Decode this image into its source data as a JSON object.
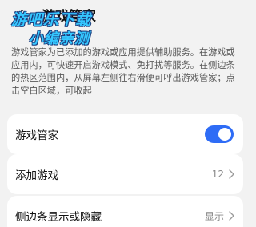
{
  "header": {
    "title": "游戏管家",
    "watermark_line1": "游吧乐下载",
    "watermark_line2": "小编亲测"
  },
  "description": "游戏管家为已添加的游戏或应用提供辅助服务。在游戏或应用内，可快速开启游戏模式、免打扰等服务。在侧边条的热区范围内，从屏幕左侧往右滑便可呼出游戏管家；点击空白区域，可收起",
  "settings": {
    "game_manager": {
      "label": "游戏管家",
      "enabled": true
    },
    "add_game": {
      "label": "添加游戏",
      "value": "12"
    },
    "sidebar": {
      "label": "侧边条显示或隐藏",
      "value": "显示"
    }
  },
  "colors": {
    "accent": "#2e6cf6",
    "background": "#f2f2f2",
    "card": "#ffffff"
  }
}
